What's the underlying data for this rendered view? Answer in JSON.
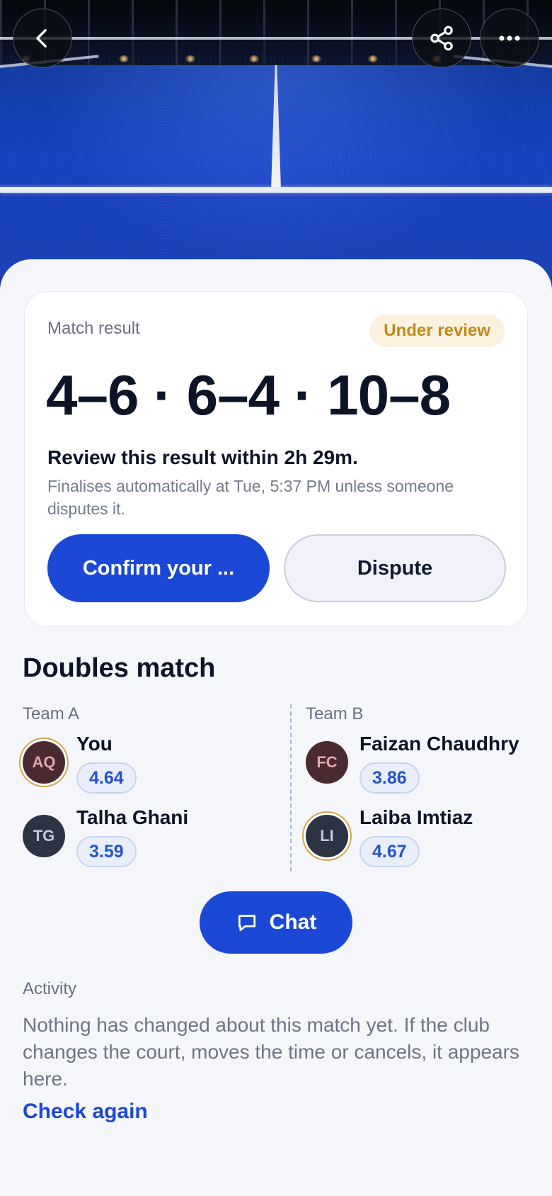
{
  "hero": {
    "back_icon": "chevron-left-icon",
    "share_icon": "share-icon",
    "more_icon": "more-horizontal-icon"
  },
  "result": {
    "label": "Match result",
    "status": "Under review",
    "status_color": "#c18a1c",
    "score": "4–6 · 6–4 · 10–8",
    "review_title": "Review this result within 2h 29m.",
    "review_desc": "Finalises automatically at Tue, 5:37 PM unless someone disputes it.",
    "confirm_label": "Confirm your ...",
    "dispute_label": "Dispute"
  },
  "match": {
    "title": "Doubles match",
    "team_a": {
      "label": "Team A",
      "players": [
        {
          "initials": "AQ",
          "name": "You",
          "rating": "4.64"
        },
        {
          "initials": "TG",
          "name": "Talha Ghani",
          "rating": "3.59"
        }
      ]
    },
    "team_b": {
      "label": "Team B",
      "players": [
        {
          "initials": "FC",
          "name": "Faizan Chaudhry",
          "rating": "3.86"
        },
        {
          "initials": "LI",
          "name": "Laiba Imtiaz",
          "rating": "4.67"
        }
      ]
    }
  },
  "chat": {
    "label": "Chat",
    "icon": "chat-bubble-icon"
  },
  "activity": {
    "label": "Activity",
    "text": "Nothing has changed about this match yet. If the club changes the court, moves the time or cancels, it appears here.",
    "check_again": "Check again"
  },
  "colors": {
    "primary": "#1c48d6",
    "background": "#f5f6f9",
    "badge_bg": "#fbf1de"
  }
}
